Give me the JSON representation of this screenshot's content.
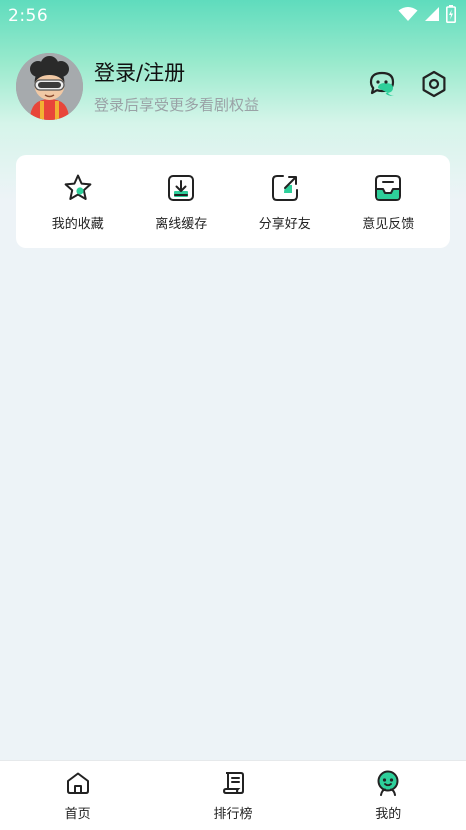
{
  "status_bar": {
    "time": "2:56",
    "icons": [
      "wifi-icon",
      "signal-icon",
      "battery-icon"
    ]
  },
  "profile": {
    "avatar_icon": "avatar",
    "title": "登录/注册",
    "subtitle": "登录后享受更多看剧权益"
  },
  "header_actions": {
    "message_icon": "chat-icon",
    "settings_icon": "gear-icon"
  },
  "quick_actions": [
    {
      "label": "我的收藏",
      "icon": "star-icon"
    },
    {
      "label": "离线缓存",
      "icon": "download-icon"
    },
    {
      "label": "分享好友",
      "icon": "share-icon"
    },
    {
      "label": "意见反馈",
      "icon": "feedback-icon"
    }
  ],
  "bottom_nav": [
    {
      "label": "首页",
      "icon": "home-icon",
      "active": false
    },
    {
      "label": "排行榜",
      "icon": "ranking-icon",
      "active": false
    },
    {
      "label": "我的",
      "icon": "profile-icon",
      "active": true
    }
  ],
  "colors": {
    "accent": "#2ecf9a",
    "header_gradient_top": "#5fdcbd",
    "page_background": "#edf3f7",
    "icon_stroke": "#222222"
  }
}
